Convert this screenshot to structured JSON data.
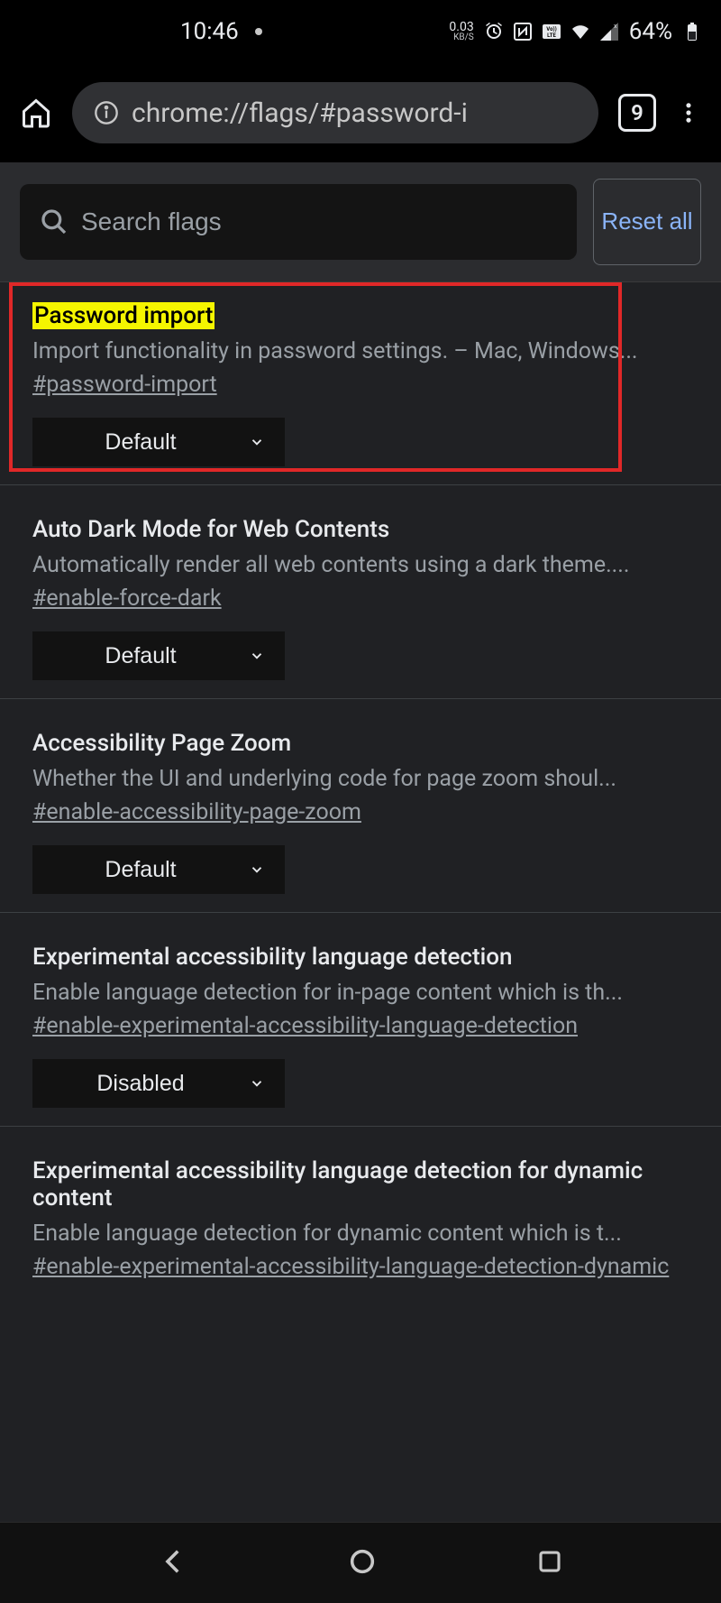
{
  "status": {
    "time": "10:46",
    "net_speed": "0.03",
    "net_unit": "KB/S",
    "battery": "64%"
  },
  "browser": {
    "url": "chrome://flags/#password-i",
    "tab_count": "9"
  },
  "search": {
    "placeholder": "Search flags",
    "reset_label": "Reset all"
  },
  "flags": [
    {
      "title": "Password import",
      "highlighted": true,
      "desc": "Import functionality in password settings. – Mac, Windows...",
      "hash": "#password-import",
      "value": "Default"
    },
    {
      "title": "Auto Dark Mode for Web Contents",
      "desc": "Automatically render all web contents using a dark theme....",
      "hash": "#enable-force-dark",
      "value": "Default"
    },
    {
      "title": "Accessibility Page Zoom",
      "desc": "Whether the UI and underlying code for page zoom shoul...",
      "hash": "#enable-accessibility-page-zoom",
      "value": "Default"
    },
    {
      "title": "Experimental accessibility language detection",
      "desc": "Enable language detection for in-page content which is th...",
      "hash": "#enable-experimental-accessibility-language-detection",
      "value": "Disabled"
    },
    {
      "title": "Experimental accessibility language detection for dynamic content",
      "desc": "Enable language detection for dynamic content which is t...",
      "hash": "#enable-experimental-accessibility-language-detection-dynamic",
      "value": ""
    }
  ]
}
